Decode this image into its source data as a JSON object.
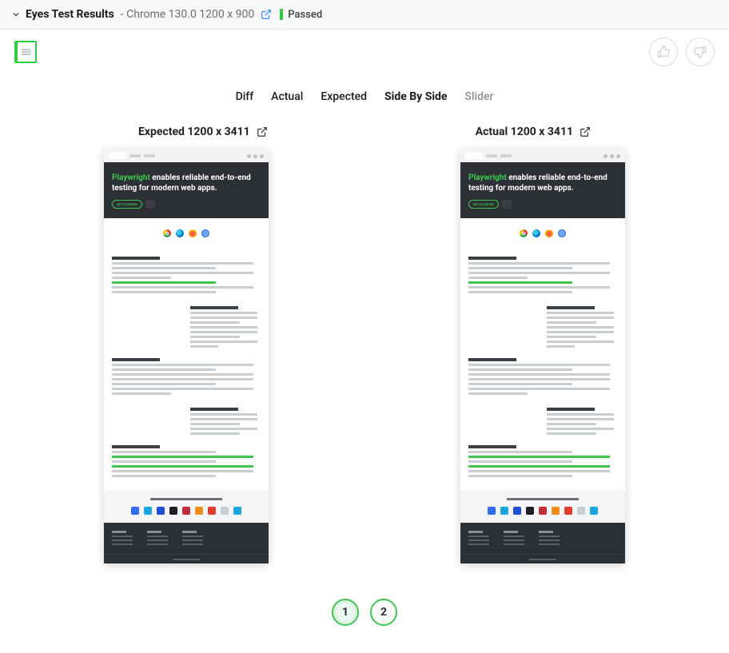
{
  "header": {
    "title_main": "Eyes Test Results",
    "title_sub": " - Chrome 130.0 1200 x 900",
    "status_label": "Passed",
    "status_color": "#2ecc40"
  },
  "viewTabs": {
    "diff": "Diff",
    "actual": "Actual",
    "expected": "Expected",
    "sideBySide": "Side By Side",
    "slider": "Slider"
  },
  "captions": {
    "expected": "Expected 1200 x 3411",
    "actual": "Actual 1200 x 3411"
  },
  "screenshotContent": {
    "hero_accent": "Playwright",
    "hero_rest": " enables reliable end-to-end testing for modern web apps.",
    "get_started": "GET STARTED"
  },
  "pagination": {
    "p1": "1",
    "p2": "2"
  }
}
